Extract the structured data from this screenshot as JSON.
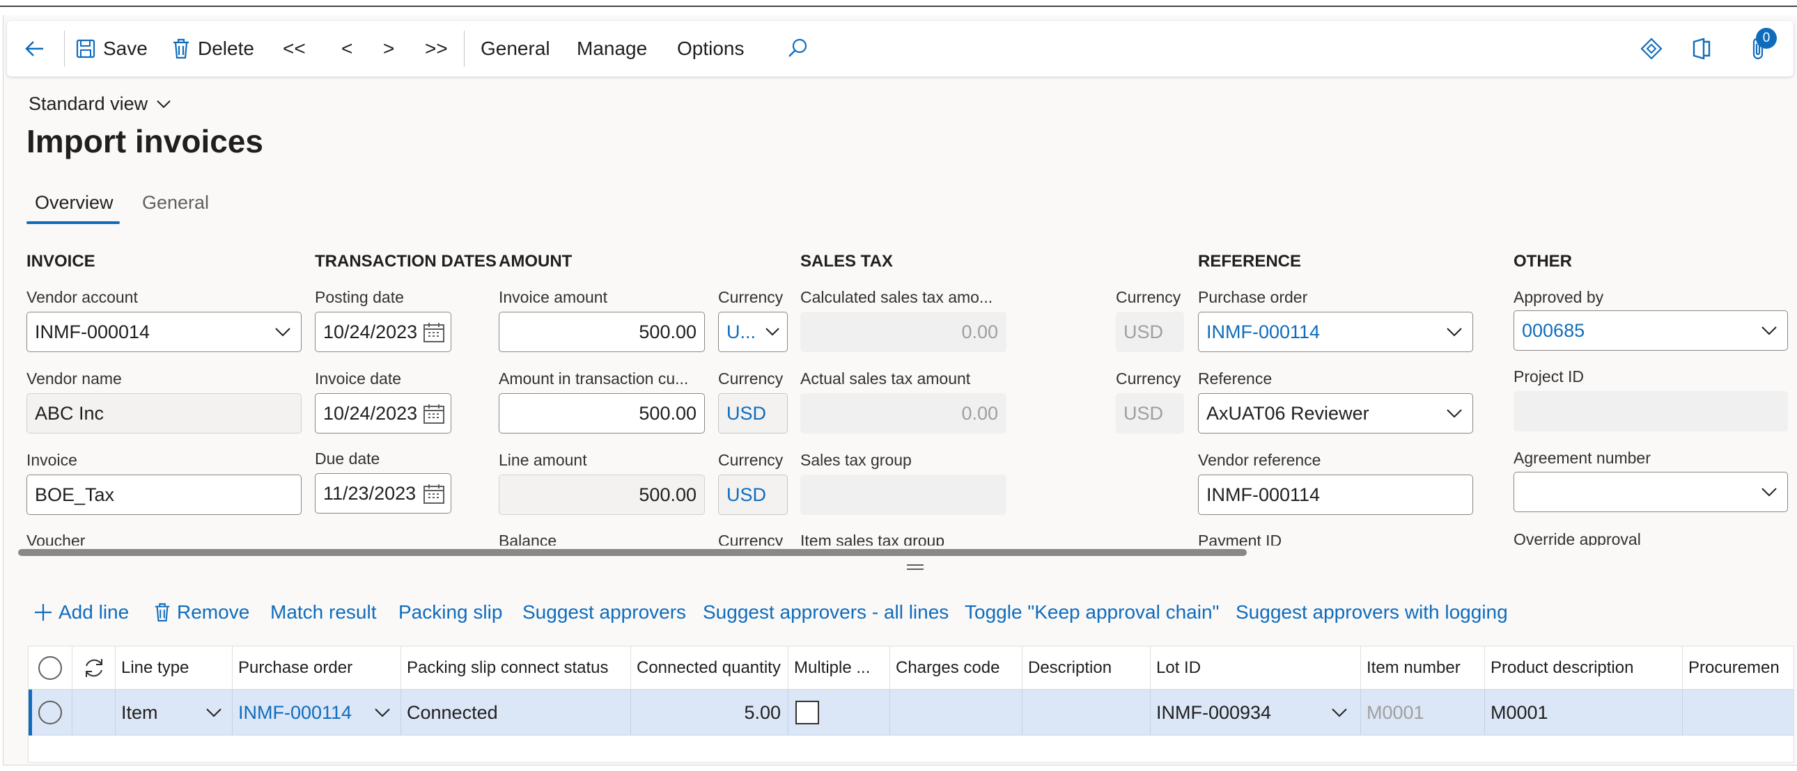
{
  "toolbar": {
    "save": "Save",
    "delete": "Delete",
    "first": "<<",
    "prev": "<",
    "next": ">",
    "last": ">>",
    "general": "General",
    "manage": "Manage",
    "options": "Options",
    "notification_count": "0"
  },
  "view_selector": "Standard view",
  "page_title": "Import invoices",
  "tabs": [
    "Overview",
    "General"
  ],
  "sections": {
    "invoice": {
      "title": "INVOICE",
      "vendor_account_label": "Vendor account",
      "vendor_account": "INMF-000014",
      "vendor_name_label": "Vendor name",
      "vendor_name": "ABC Inc",
      "invoice_label": "Invoice",
      "invoice": "BOE_Tax",
      "voucher_label": "Voucher"
    },
    "transaction_dates": {
      "title": "TRANSACTION DATES",
      "posting_date_label": "Posting date",
      "posting_date": "10/24/2023",
      "invoice_date_label": "Invoice date",
      "invoice_date": "10/24/2023",
      "due_date_label": "Due date",
      "due_date": "11/23/2023"
    },
    "amount": {
      "title": "AMOUNT",
      "invoice_amount_label": "Invoice amount",
      "invoice_amount": "500.00",
      "amount_tc_label": "Amount in transaction cu...",
      "amount_tc": "500.00",
      "line_amount_label": "Line amount",
      "line_amount": "500.00",
      "balance_label": "Balance",
      "currency_label": "Currency",
      "currency_1": "U...",
      "currency_2": "USD",
      "currency_3": "USD"
    },
    "sales_tax": {
      "title": "SALES TAX",
      "calculated_label": "Calculated sales tax amo...",
      "calculated": "0.00",
      "actual_label": "Actual sales tax amount",
      "actual": "0.00",
      "group_label": "Sales tax group",
      "item_group_label": "Item sales tax group",
      "currency_label": "Currency",
      "currency_1": "USD",
      "currency_2": "USD"
    },
    "reference": {
      "title": "REFERENCE",
      "purchase_order_label": "Purchase order",
      "purchase_order": "INMF-000114",
      "reference_label": "Reference",
      "reference": "AxUAT06 Reviewer",
      "vendor_reference_label": "Vendor reference",
      "vendor_reference": "INMF-000114",
      "payment_id_label": "Payment ID"
    },
    "other": {
      "title": "OTHER",
      "approved_by_label": "Approved by",
      "approved_by": "000685",
      "project_id_label": "Project ID",
      "agreement_label": "Agreement number",
      "override_label": "Override approval"
    }
  },
  "line_actions": {
    "add_line": "Add line",
    "remove": "Remove",
    "match_result": "Match result",
    "packing_slip": "Packing slip",
    "suggest_approvers": "Suggest approvers",
    "suggest_all": "Suggest approvers - all lines",
    "toggle_keep": "Toggle \"Keep approval chain\"",
    "suggest_logging": "Suggest approvers with logging"
  },
  "grid": {
    "columns": [
      "Line type",
      "Purchase order",
      "Packing slip connect status",
      "Connected quantity",
      "Multiple ...",
      "Charges code",
      "Description",
      "Lot ID",
      "Item number",
      "Product description",
      "Procuremen"
    ],
    "rows": [
      {
        "line_type": "Item",
        "purchase_order": "INMF-000114",
        "status": "Connected",
        "quantity": "5.00",
        "charges_code": "",
        "description": "",
        "lot_id": "INMF-000934",
        "item_number": "M0001",
        "product_description": "M0001"
      }
    ]
  },
  "colors": {
    "accent": "#0f6cbd",
    "selected_row": "#dbe6f7",
    "readonly_bg": "#f3f2f1"
  }
}
